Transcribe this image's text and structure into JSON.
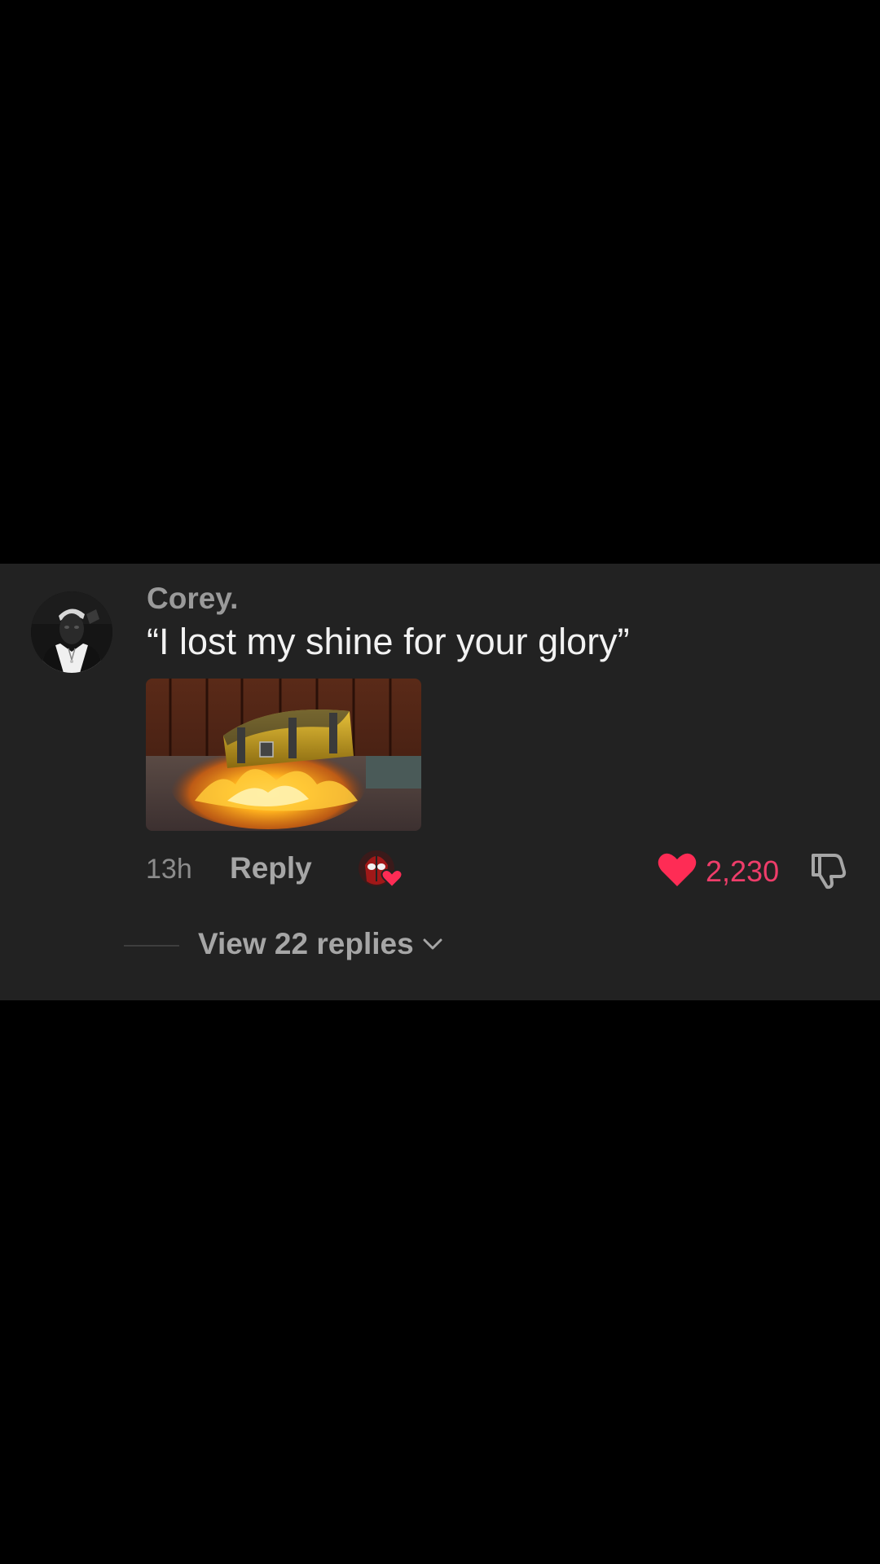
{
  "comment": {
    "username": "Corey.",
    "text": "“I lost my shine for your glory”",
    "time": "13h",
    "reply_label": "Reply",
    "like_count": "2,230",
    "liked": true,
    "view_replies_label": "View 22 replies",
    "avatar_icon": "user-avatar-icon",
    "image_description_icon": "treasure-chest-gif"
  },
  "colors": {
    "background": "#000000",
    "card": "#222222",
    "like_accent": "#fe2c55",
    "like_count": "#ee3d6a",
    "muted_text": "#a6a6a6"
  }
}
